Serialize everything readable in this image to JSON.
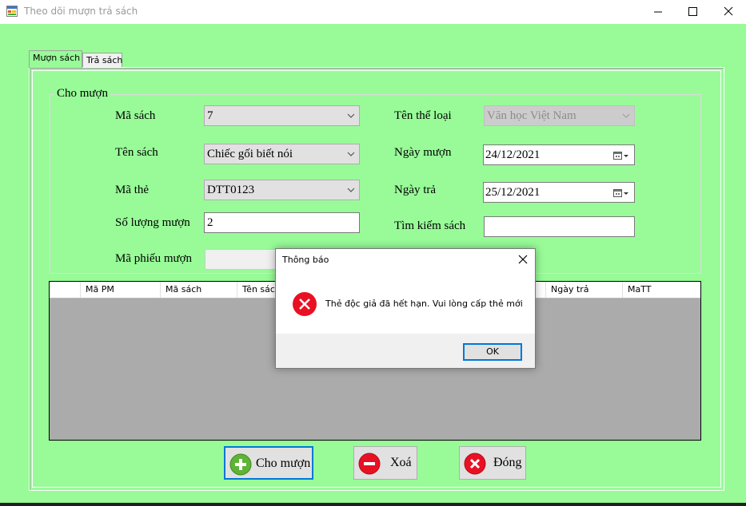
{
  "window": {
    "title": "Theo dõi mượn trả sách",
    "icon": "app-form-icon",
    "controls": [
      "minimize-icon",
      "maximize-icon",
      "close-icon"
    ]
  },
  "tabs": [
    {
      "label": "Mượn sách",
      "active": true
    },
    {
      "label": "Trả sách",
      "active": false
    }
  ],
  "group": {
    "title": "Cho mượn"
  },
  "form": {
    "ma_sach": {
      "label": "Mã sách",
      "value": "7"
    },
    "ten_sach": {
      "label": "Tên sách",
      "value": "Chiếc gối biết nói"
    },
    "ma_the": {
      "label": "Mã thẻ",
      "value": "DTT0123"
    },
    "so_luong": {
      "label": "Số lượng mượn",
      "value": "2"
    },
    "ma_phieu": {
      "label": "Mã phiếu mượn",
      "value": ""
    },
    "ten_the_loai": {
      "label": "Tên thể loại",
      "value": "Văn học Việt Nam"
    },
    "ngay_muon": {
      "label": "Ngày mượn",
      "value": "24/12/2021"
    },
    "ngay_tra": {
      "label": "Ngày trả",
      "value": "25/12/2021"
    },
    "tim_kiem": {
      "label": "Tìm kiếm sách",
      "value": ""
    }
  },
  "grid": {
    "columns": [
      "Mã PM",
      "Mã sách",
      "Tên sách",
      "",
      "",
      "",
      "Ngày trả",
      "MaTT"
    ],
    "rows": []
  },
  "buttons": {
    "cho_muon": "Cho mượn",
    "xoa": "Xoá",
    "dong": "Đóng"
  },
  "dialog": {
    "title": "Thông báo",
    "message": "Thẻ độc giả đã hết hạn. Vui lòng cấp thẻ mới",
    "ok": "OK",
    "icon": "error-icon"
  },
  "colors": {
    "form_background": "#98fb98",
    "grid_background": "#ababab",
    "focus_border": "#0078d7",
    "error_red": "#e81123",
    "add_green": "#5fb336"
  }
}
